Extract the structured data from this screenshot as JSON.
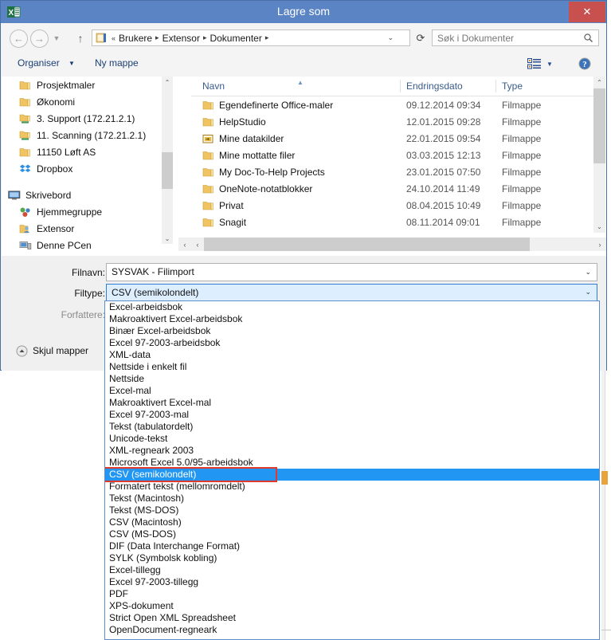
{
  "window": {
    "title": "Lagre som",
    "app_icon": "excel-icon",
    "close_label": "✕"
  },
  "nav": {
    "back_icon": "back-arrow-icon",
    "forward_icon": "forward-arrow-icon",
    "history_icon": "chevron-down-icon",
    "up_icon": "up-arrow-icon",
    "refresh_icon": "refresh-icon",
    "breadcrumb_prefix": "«",
    "breadcrumb": [
      "Brukere",
      "Extensor",
      "Dokumenter"
    ],
    "breadcrumb_caret": "⌄"
  },
  "search": {
    "placeholder": "Søk i Dokumenter",
    "icon": "search-icon"
  },
  "toolbar": {
    "organiser_label": "Organiser",
    "organiser_caret": "▼",
    "new_folder_label": "Ny mappe",
    "view_icon": "view-list-icon",
    "view_caret": "▼",
    "help_icon": "help-icon"
  },
  "nav_pane": {
    "items": [
      {
        "label": "Prosjektmaler",
        "icon": "folder-icon",
        "indent": 1
      },
      {
        "label": "Økonomi",
        "icon": "folder-icon",
        "indent": 1
      },
      {
        "label": "3. Support (172.21.2.1)",
        "icon": "network-folder-icon",
        "indent": 1
      },
      {
        "label": "11. Scanning (172.21.2.1)",
        "icon": "network-folder-icon",
        "indent": 1
      },
      {
        "label": "11150 Løft AS",
        "icon": "folder-icon",
        "indent": 1
      },
      {
        "label": "Dropbox",
        "icon": "dropbox-icon",
        "indent": 1
      },
      {
        "label": "",
        "icon": "spacer",
        "indent": 0
      },
      {
        "label": "Skrivebord",
        "icon": "desktop-icon",
        "indent": 0
      },
      {
        "label": "Hjemmegruppe",
        "icon": "homegroup-icon",
        "indent": 1
      },
      {
        "label": "Extensor",
        "icon": "user-folder-icon",
        "indent": 1
      },
      {
        "label": "Denne PCen",
        "icon": "computer-icon",
        "indent": 1
      }
    ],
    "scroll_up": "⌃",
    "scroll_down": "⌄",
    "collapse": "‹"
  },
  "file_list": {
    "columns": [
      "Navn",
      "Endringsdato",
      "Type"
    ],
    "sort_arrow": "▲",
    "rows": [
      {
        "name": "Egendefinerte Office-maler",
        "date": "09.12.2014 09:34",
        "type": "Filmappe",
        "icon": "folder-icon"
      },
      {
        "name": "HelpStudio",
        "date": "12.01.2015 09:28",
        "type": "Filmappe",
        "icon": "folder-icon"
      },
      {
        "name": "Mine datakilder",
        "date": "22.01.2015 09:54",
        "type": "Filmappe",
        "icon": "special-folder-icon"
      },
      {
        "name": "Mine mottatte filer",
        "date": "03.03.2015 12:13",
        "type": "Filmappe",
        "icon": "folder-icon"
      },
      {
        "name": "My Doc-To-Help Projects",
        "date": "23.01.2015 07:50",
        "type": "Filmappe",
        "icon": "folder-icon"
      },
      {
        "name": "OneNote-notatblokker",
        "date": "24.10.2014 11:49",
        "type": "Filmappe",
        "icon": "folder-icon"
      },
      {
        "name": "Privat",
        "date": "08.04.2015 10:49",
        "type": "Filmappe",
        "icon": "folder-icon"
      },
      {
        "name": "Snagit",
        "date": "08.11.2014 09:01",
        "type": "Filmappe",
        "icon": "folder-icon"
      }
    ],
    "scroll_up": "⌃",
    "scroll_down": "⌄",
    "hscroll_left": "‹",
    "hscroll_right": "›"
  },
  "form": {
    "filename_label": "Filnavn:",
    "filename_value": "SYSVAK - Filimport",
    "filename_caret": "⌄",
    "filetype_label": "Filtype:",
    "filetype_value": "CSV (semikolondelt)",
    "filetype_caret": "⌄",
    "authors_label": "Forfattere:",
    "hide_folders_label": "Skjul mapper",
    "hide_folders_icon": "collapse-up-icon"
  },
  "filetype_dropdown": {
    "selected": "CSV (semikolondelt)",
    "options": [
      "Excel-arbeidsbok",
      "Makroaktivert Excel-arbeidsbok",
      "Binær Excel-arbeidsbok",
      "Excel 97-2003-arbeidsbok",
      "XML-data",
      "Nettside i enkelt fil",
      "Nettside",
      "Excel-mal",
      "Makroaktivert Excel-mal",
      "Excel 97-2003-mal",
      "Tekst (tabulatordelt)",
      "Unicode-tekst",
      "XML-regneark 2003",
      "Microsoft Excel 5.0/95-arbeidsbok",
      "CSV (semikolondelt)",
      "Formatert tekst (mellomromdelt)",
      "Tekst (Macintosh)",
      "Tekst (MS-DOS)",
      "CSV (Macintosh)",
      "CSV (MS-DOS)",
      "DIF (Data Interchange Format)",
      "SYLK (Symbolsk kobling)",
      "Excel-tillegg",
      "Excel 97-2003-tillegg",
      "PDF",
      "XPS-dokument",
      "Strict Open XML Spreadsheet",
      "OpenDocument-regneark"
    ],
    "highlight_color": "#e03a2f",
    "selection_color": "#2196f3"
  },
  "colors": {
    "title_bar": "#5b84c4",
    "close_button": "#c8514f",
    "dialog_bg": "#f0f0f0",
    "accent_link": "#1b3f75"
  }
}
